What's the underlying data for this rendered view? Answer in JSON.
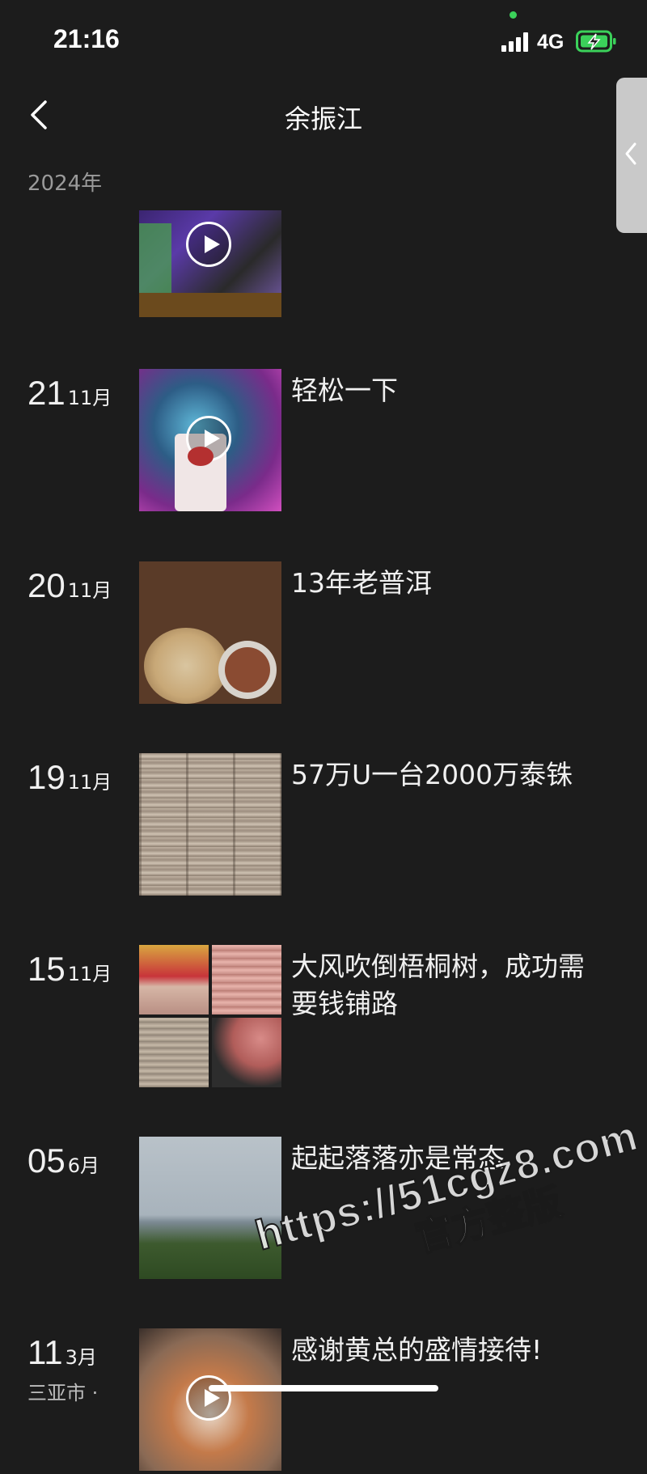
{
  "status_bar": {
    "time": "21:16",
    "network": "4G",
    "signal_bars": 4,
    "battery_icon": "battery-charging-icon"
  },
  "header": {
    "back_icon": "chevron-left-icon",
    "title": "余振江",
    "year": "2024年"
  },
  "side_handle": {
    "icon": "chevron-left-icon"
  },
  "posts": [
    {
      "day": "",
      "month": "",
      "caption": "",
      "media": "video",
      "thumb": "club"
    },
    {
      "day": "21",
      "month": "11月",
      "caption": "轻松一下",
      "media": "video",
      "thumb": "drink"
    },
    {
      "day": "20",
      "month": "11月",
      "caption": "13年老普洱",
      "media": "image",
      "thumb": "tea"
    },
    {
      "day": "19",
      "month": "11月",
      "caption": "57万U一台2000万泰铢",
      "media": "image",
      "thumb": "cash"
    },
    {
      "day": "15",
      "month": "11月",
      "caption": "大风吹倒梧桐树，成功需要钱铺路",
      "media": "grid",
      "thumb": "cash-grid"
    },
    {
      "day": "05",
      "month": "6月",
      "caption": "起起落落亦是常态",
      "media": "image",
      "thumb": "sea"
    },
    {
      "day": "11",
      "month": "3月",
      "location": "三亚市 ·",
      "caption": "感谢黄总的盛情接待!",
      "media": "video",
      "thumb": "food"
    }
  ],
  "watermark": {
    "url": "https://51cgz8.com",
    "sub": "官方整版"
  },
  "colors": {
    "background": "#1c1c1c",
    "text": "#f0f0f0",
    "secondary_text": "#9a9a9a",
    "charging_green": "#3bd15a"
  }
}
